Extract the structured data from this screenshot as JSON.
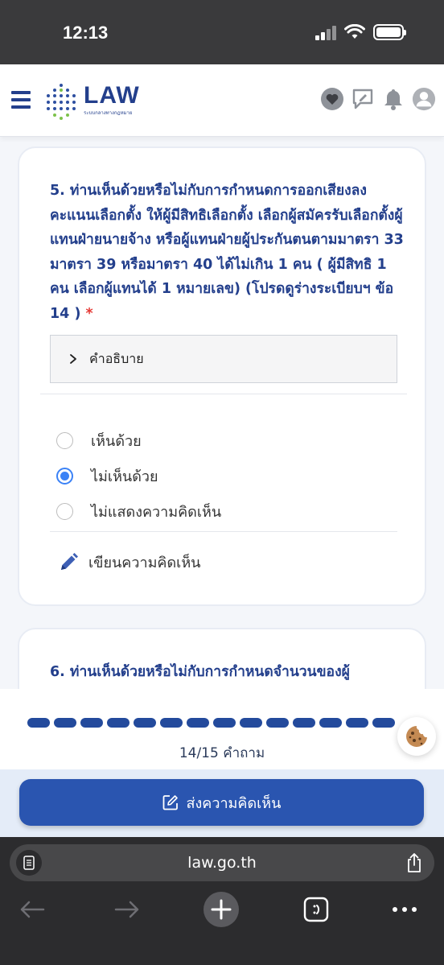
{
  "status_bar": {
    "time": "12:13"
  },
  "header": {
    "logo_text": "LAW",
    "logo_subtitle": "ระบบกลางทางกฎหมาย",
    "icons": [
      "menu-icon",
      "heart-icon",
      "comment-icon",
      "bell-icon",
      "user-icon"
    ]
  },
  "question5": {
    "text": "5. ท่านเห็นด้วยหรือไม่กับการกำหนดการออกเสียงลงคะแนนเลือกตั้ง ให้ผู้มีสิทธิเลือกตั้ง เลือกผู้สมัครรับเลือกตั้งผู้แทนฝ่ายนายจ้าง หรือผู้แทนฝ่ายผู้ประกันตนตามมาตรา 33 มาตรา 39 หรือมาตรา 40 ได้ไม่เกิน 1 คน ( ผู้มีสิทธิ 1 คน เลือกผู้แทนได้ 1 หมายเลข) (โปรดดูร่างระเบียบฯ ข้อ 14 )",
    "required_mark": "*",
    "explain_label": "คำอธิบาย",
    "options": [
      {
        "label": "เห็นด้วย",
        "selected": false
      },
      {
        "label": "ไม่เห็นด้วย",
        "selected": true
      },
      {
        "label": "ไม่แสดงความคิดเห็น",
        "selected": false
      }
    ],
    "comment_label": "เขียนความคิดเห็น"
  },
  "question6": {
    "text": "6. ท่านเห็นด้วยหรือไม่กับการกำหนดจำนวนของผู้"
  },
  "progress": {
    "answered": 14,
    "total": 15,
    "label": "14/15 คำถาม"
  },
  "submit": {
    "label": "ส่งความคิดเห็น"
  },
  "browser": {
    "url": "law.go.th"
  },
  "colors": {
    "brand": "#233f8c",
    "accent": "#3b82f6",
    "submit": "#2a55b0",
    "required": "#e53935"
  }
}
